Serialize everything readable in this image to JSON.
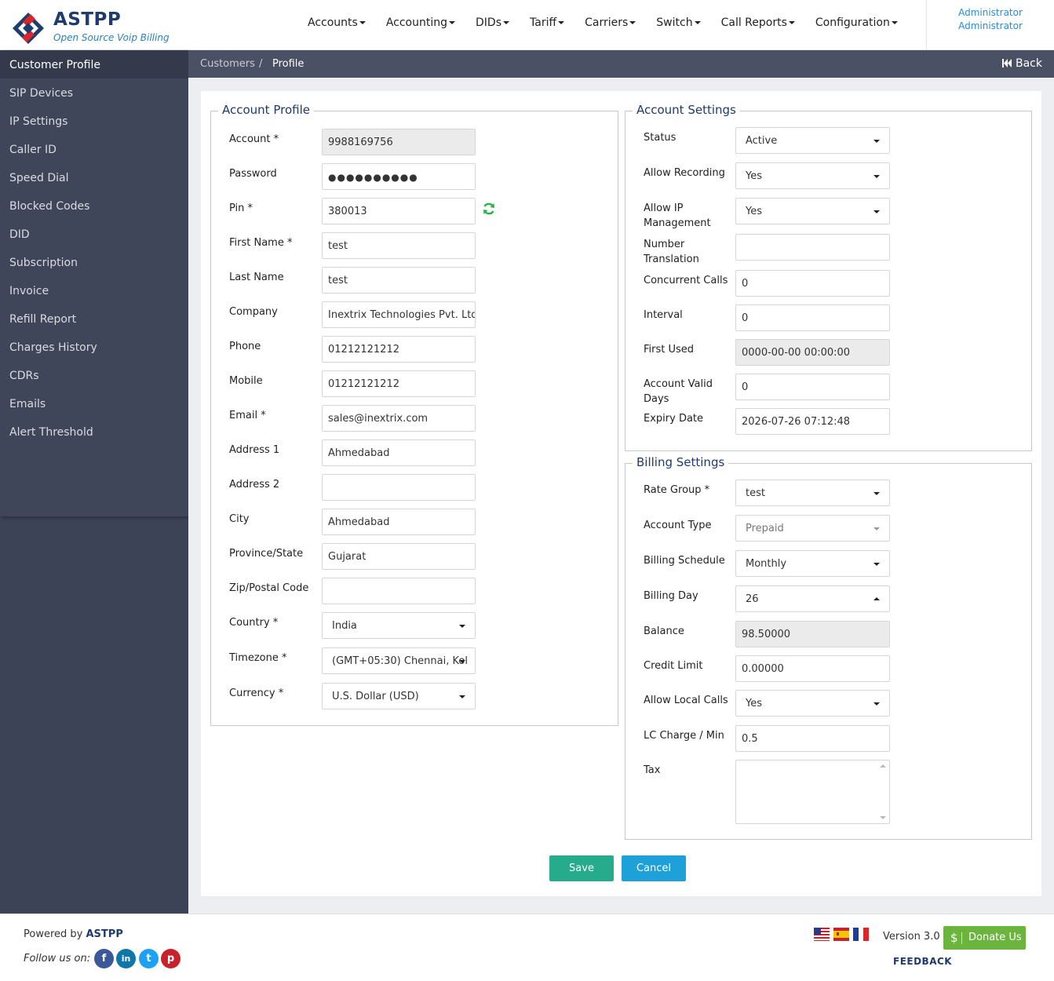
{
  "header": {
    "logo_title": "ASTPP",
    "logo_subtitle": "Open Source Voip Billing",
    "nav": [
      "Accounts",
      "Accounting",
      "DIDs",
      "Tariff",
      "Carriers",
      "Switch",
      "Call Reports",
      "Configuration"
    ],
    "user_line1": "Administrator",
    "user_line2": "Administrator"
  },
  "sidebar": {
    "items": [
      "Customer Profile",
      "SIP Devices",
      "IP Settings",
      "Caller ID",
      "Speed Dial",
      "Blocked Codes",
      "DID",
      "Subscription",
      "Invoice",
      "Refill Report",
      "Charges History",
      "CDRs",
      "Emails",
      "Alert Threshold"
    ],
    "active": "Customer Profile"
  },
  "breadcrumb": {
    "parent": "Customers",
    "separator": "/",
    "current": "Profile",
    "back_label": "Back"
  },
  "account_profile": {
    "legend": "Account Profile",
    "fields": [
      {
        "label": "Account *",
        "value": "9988169756",
        "kind": "readonly"
      },
      {
        "label": "Password",
        "value": "●●●●●●●●●●",
        "kind": "password"
      },
      {
        "label": "Pin *",
        "value": "380013",
        "kind": "text"
      },
      {
        "label": "First Name *",
        "value": "test",
        "kind": "text"
      },
      {
        "label": "Last Name",
        "value": "test",
        "kind": "text"
      },
      {
        "label": "Company",
        "value": "Inextrix Technologies Pvt. Ltd.",
        "kind": "text"
      },
      {
        "label": "Phone",
        "value": "01212121212",
        "kind": "text"
      },
      {
        "label": "Mobile",
        "value": "01212121212",
        "kind": "text"
      },
      {
        "label": "Email *",
        "value": "sales@inextrix.com",
        "kind": "text"
      },
      {
        "label": "Address 1",
        "value": "Ahmedabad",
        "kind": "text"
      },
      {
        "label": "Address 2",
        "value": "",
        "kind": "text"
      },
      {
        "label": "City",
        "value": "Ahmedabad",
        "kind": "text"
      },
      {
        "label": "Province/State",
        "value": "Gujarat",
        "kind": "text"
      },
      {
        "label": "Zip/Postal Code",
        "value": "",
        "kind": "text"
      },
      {
        "label": "Country *",
        "value": "India",
        "kind": "select"
      },
      {
        "label": "Timezone *",
        "value": "(GMT+05:30) Chennai, Kol",
        "kind": "select"
      },
      {
        "label": "Currency *",
        "value": "U.S. Dollar (USD)",
        "kind": "select"
      }
    ]
  },
  "account_settings": {
    "legend": "Account Settings",
    "fields": [
      {
        "label": "Status",
        "value": "Active",
        "kind": "select"
      },
      {
        "label": "Allow Recording",
        "value": "Yes",
        "kind": "select"
      },
      {
        "label": "Allow IP Management",
        "value": "Yes",
        "kind": "select"
      },
      {
        "label": "Number Translation",
        "value": "",
        "kind": "text"
      },
      {
        "label": "Concurrent Calls",
        "value": "0",
        "kind": "text"
      },
      {
        "label": "Interval",
        "value": "0",
        "kind": "text"
      },
      {
        "label": "First Used",
        "value": "0000-00-00 00:00:00",
        "kind": "readonly"
      },
      {
        "label": "Account Valid Days",
        "value": "0",
        "kind": "text"
      },
      {
        "label": "Expiry Date",
        "value": "2026-07-26 07:12:48",
        "kind": "text"
      }
    ]
  },
  "billing_settings": {
    "legend": "Billing Settings",
    "fields": [
      {
        "label": "Rate Group *",
        "value": "test",
        "kind": "select"
      },
      {
        "label": "Account Type",
        "value": "Prepaid",
        "kind": "select-disabled"
      },
      {
        "label": "Billing Schedule",
        "value": "Monthly",
        "kind": "select"
      },
      {
        "label": "Billing Day",
        "value": "26",
        "kind": "select-open"
      },
      {
        "label": "Balance",
        "value": "98.50000",
        "kind": "readonly"
      },
      {
        "label": "Credit Limit",
        "value": "0.00000",
        "kind": "text"
      },
      {
        "label": "Allow Local Calls",
        "value": "Yes",
        "kind": "select"
      },
      {
        "label": "LC Charge / Min",
        "value": "0.5",
        "kind": "text"
      },
      {
        "label": "Tax",
        "value": "",
        "kind": "textarea"
      }
    ]
  },
  "buttons": {
    "save": "Save",
    "cancel": "Cancel"
  },
  "footer": {
    "powered_prefix": "Powered by",
    "powered_brand": "ASTPP",
    "follow": "Follow us on:",
    "social": [
      {
        "name": "facebook-icon",
        "glyph": "f",
        "color": "#3b5998"
      },
      {
        "name": "linkedin-icon",
        "glyph": "in",
        "color": "#0e76a8"
      },
      {
        "name": "twitter-icon",
        "glyph": "t",
        "color": "#1da1f2"
      },
      {
        "name": "pinterest-icon",
        "glyph": "p",
        "color": "#c8232c"
      }
    ],
    "flags": [
      "us-flag-icon",
      "es-flag-icon",
      "fr-flag-icon"
    ],
    "version": "Version 3.0",
    "donate_symbol": "$",
    "donate": "Donate Us",
    "feedback": "FEEDBACK"
  },
  "colors": {
    "brand": "#1e3a6e",
    "sidebar": "#3c4356",
    "save": "#26ab8c",
    "cancel": "#1ea0d8",
    "donate": "#6bb43e",
    "refresh": "#2bb34a"
  }
}
